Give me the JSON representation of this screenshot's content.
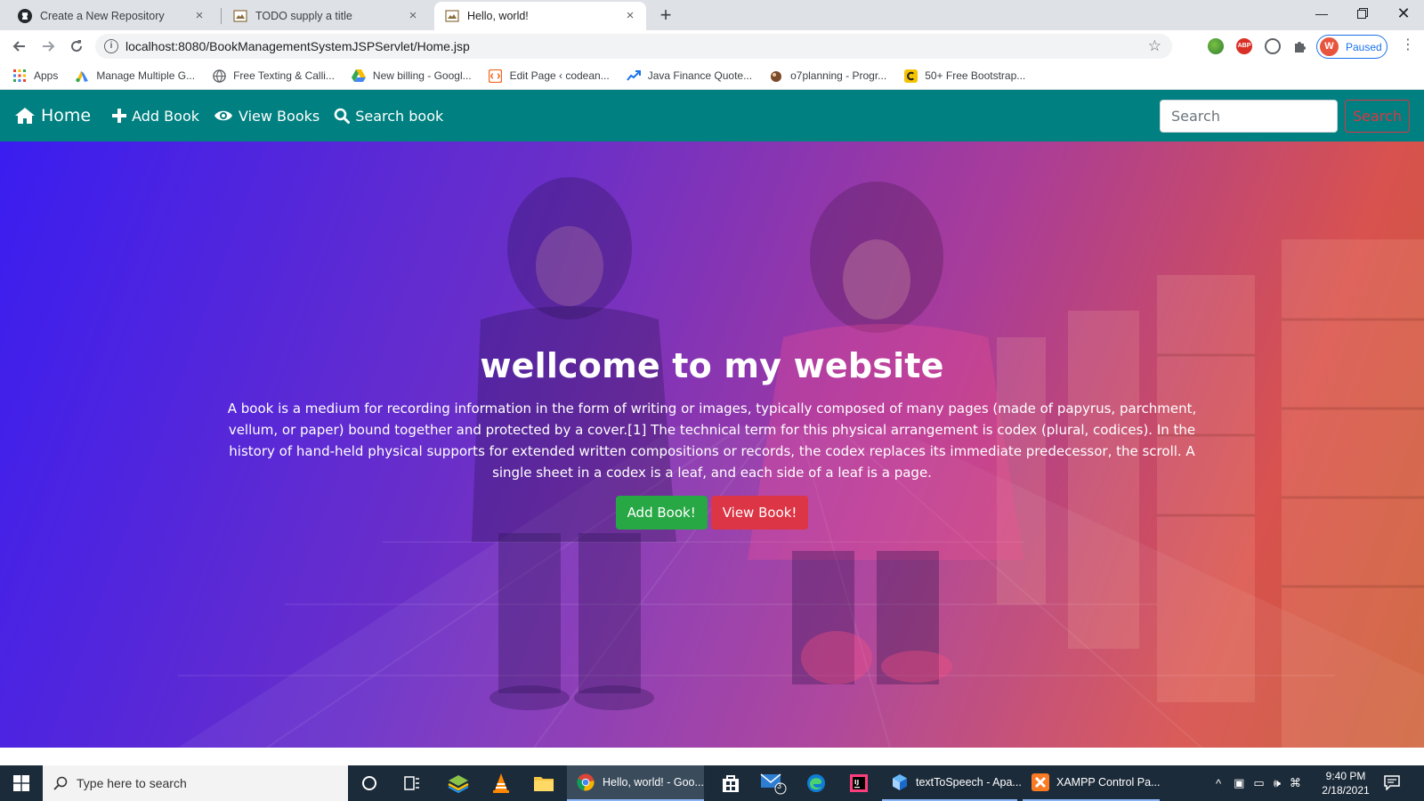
{
  "browser": {
    "tabs": [
      {
        "title": "Create a New Repository",
        "icon": "github-icon",
        "active": false
      },
      {
        "title": "TODO supply a title",
        "icon": "page-icon",
        "active": false
      },
      {
        "title": "Hello, world!",
        "icon": "page-icon",
        "active": true
      }
    ],
    "url": "localhost:8080/BookManagementSystemJSPServlet/Home.jsp",
    "profile": {
      "initial": "W",
      "status": "Paused"
    },
    "bookmarks": [
      {
        "label": "Apps",
        "icon": "apps-grid-icon"
      },
      {
        "label": "Manage Multiple G...",
        "icon": "google-ads-icon"
      },
      {
        "label": "Free Texting & Calli...",
        "icon": "globe-icon"
      },
      {
        "label": "New billing - Googl...",
        "icon": "google-drive-icon"
      },
      {
        "label": "Edit Page ‹ codean...",
        "icon": "codeanywhere-icon"
      },
      {
        "label": "Java Finance Quote...",
        "icon": "trend-icon"
      },
      {
        "label": "o7planning - Progr...",
        "icon": "o7planning-icon"
      },
      {
        "label": "50+ Free Bootstrap...",
        "icon": "c-logo-icon"
      }
    ]
  },
  "site": {
    "nav": {
      "home": "Home",
      "add_book": "Add Book",
      "view_books": "View Books",
      "search_book": "Search book",
      "search_placeholder": "Search",
      "search_button": "Search"
    },
    "hero": {
      "title": "wellcome to my website",
      "text": "A book is a medium for recording information in the form of writing or images, typically composed of many pages (made of papyrus, parchment, vellum, or paper) bound together and protected by a cover.[1] The technical term for this physical arrangement is codex (plural, codices). In the history of hand-held physical supports for extended written compositions or records, the codex replaces its immediate predecessor, the scroll. A single sheet in a codex is a leaf, and each side of a leaf is a page.",
      "add_button": "Add Book!",
      "view_button": "View Book!"
    }
  },
  "taskbar": {
    "search_placeholder": "Type here to search",
    "apps": [
      {
        "label": "Hello, world! - Goo...",
        "icon": "chrome-icon",
        "active": true
      },
      {
        "label": "textToSpeech - Apa...",
        "icon": "netbeans-icon",
        "active": false
      },
      {
        "label": "XAMPP Control Pa...",
        "icon": "xampp-icon",
        "active": false
      }
    ],
    "mail_badge": "3",
    "time": "9:40 PM",
    "date": "2/18/2021"
  },
  "colors": {
    "navbar": "#008080",
    "gradient_start": "#3a1df0",
    "gradient_end": "#d8524f",
    "btn_green": "#28a745",
    "btn_red": "#dc3545"
  }
}
